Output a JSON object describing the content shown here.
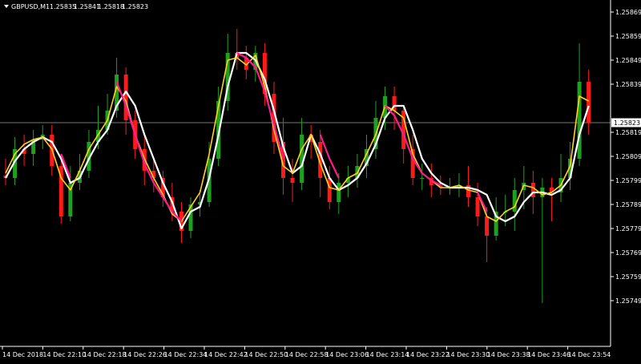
{
  "window": {
    "menu_icon": "triangle-down-icon",
    "symbol": "GBPUSD,M1",
    "ohlc": [
      "1.25835",
      "1.25841",
      "1.25818",
      "1.25823"
    ]
  },
  "colors": {
    "background": "#000000",
    "bull": "#1fa01f",
    "bear": "#ff1a1a",
    "ma_white": "#ffffff",
    "ma_yellow": "#ffd21e",
    "ma_magenta": "#ff1a8c",
    "bid_line": "#a0a0a0",
    "axis": "#ffffff"
  },
  "chart_data": {
    "type": "candlestick",
    "symbol": "GBPUSD",
    "timeframe": "M1",
    "ylim": [
      1.25744,
      1.25874
    ],
    "y_ticks": [
      "1.25869",
      "1.25859",
      "1.25849",
      "1.25839",
      "1.25819",
      "1.25809",
      "1.25799",
      "1.25789",
      "1.25779",
      "1.25769",
      "1.25759",
      "1.25749"
    ],
    "current_price": "1.25823",
    "x_ticks": [
      "14 Dec 2018",
      "14 Dec 22:10",
      "14 Dec 22:18",
      "14 Dec 22:26",
      "14 Dec 22:34",
      "14 Dec 22:42",
      "14 Dec 22:50",
      "14 Dec 22:58",
      "14 Dec 23:06",
      "14 Dec 23:14",
      "14 Dec 23:22",
      "14 Dec 23:30",
      "14 Dec 23:38",
      "14 Dec 23:46",
      "14 Dec 23:54"
    ],
    "series": [
      {
        "name": "",
        "color": "white",
        "values": [
          1.258,
          1.25807,
          1.25812,
          1.25815,
          1.25817,
          1.25815,
          1.25808,
          1.25798,
          1.258,
          1.25808,
          1.25815,
          1.2582,
          1.2583,
          1.25836,
          1.2583,
          1.25818,
          1.25808,
          1.25798,
          1.2579,
          1.25779,
          1.25786,
          1.25788,
          1.258,
          1.25818,
          1.25838,
          1.25852,
          1.25852,
          1.25849,
          1.25841,
          1.25828,
          1.25813,
          1.25802,
          1.25805,
          1.25818,
          1.2581,
          1.258,
          1.25795,
          1.25797,
          1.258,
          1.25806,
          1.25814,
          1.25825,
          1.2583,
          1.2583,
          1.2582,
          1.25808,
          1.25802,
          1.25798,
          1.25796,
          1.25796,
          1.25796,
          1.25795,
          1.25793,
          1.25784,
          1.25782,
          1.25784,
          1.2579,
          1.25794,
          1.25794,
          1.25793,
          1.25795,
          1.258,
          1.25818,
          1.2583
        ]
      },
      {
        "name": "",
        "color": "yellow",
        "values": [
          1.25802,
          1.2581,
          1.25814,
          1.25816,
          1.25817,
          1.25812,
          1.258,
          1.25795,
          1.25803,
          1.25812,
          1.25818,
          1.25824,
          1.25838,
          1.25832,
          1.25818,
          1.25808,
          1.258,
          1.25793,
          1.25785,
          1.25782,
          1.25788,
          1.25794,
          1.2581,
          1.2583,
          1.25849,
          1.2585,
          1.25847,
          1.25851,
          1.25838,
          1.2582,
          1.25805,
          1.25802,
          1.25812,
          1.25818,
          1.25806,
          1.25796,
          1.25795,
          1.258,
          1.25802,
          1.2581,
          1.25818,
          1.2583,
          1.25828,
          1.25825,
          1.2581,
          1.25802,
          1.25799,
          1.25796,
          1.25796,
          1.25797,
          1.25795,
          1.25794,
          1.25784,
          1.25782,
          1.25786,
          1.25788,
          1.25797,
          1.25796,
          1.25793,
          1.25794,
          1.25797,
          1.25805,
          1.25834,
          1.25832
        ]
      },
      {
        "name": "",
        "color": "magenta",
        "values": [
          null,
          null,
          null,
          null,
          null,
          null,
          1.2581,
          1.258,
          null,
          null,
          null,
          null,
          1.2584,
          1.2583,
          1.25818,
          1.25806,
          1.25798,
          1.25792,
          1.25786,
          1.25782,
          null,
          null,
          null,
          null,
          null,
          1.25852,
          1.2585,
          1.25846,
          1.25836,
          1.25822,
          1.25808,
          null,
          null,
          null,
          1.25818,
          1.25808,
          1.258,
          null,
          null,
          null,
          null,
          1.2583,
          1.25826,
          1.25818,
          1.25808,
          1.25802,
          1.25799,
          1.25797,
          null,
          null,
          null,
          1.25794,
          1.25786,
          null,
          null,
          null,
          null,
          null,
          null,
          null,
          null,
          null,
          null,
          null
        ]
      }
    ],
    "candles": [
      [
        1.25801,
        1.258,
        1.25808,
        1.25797
      ],
      [
        1.258,
        1.25812,
        1.25817,
        1.25797
      ],
      [
        1.25812,
        1.2581,
        1.25818,
        1.25805
      ],
      [
        1.2581,
        1.25816,
        1.2582,
        1.25805
      ],
      [
        1.25816,
        1.25818,
        1.25822,
        1.25812
      ],
      [
        1.25818,
        1.25805,
        1.25822,
        1.25801
      ],
      [
        1.25805,
        1.25784,
        1.2581,
        1.25781
      ],
      [
        1.25784,
        1.25798,
        1.25805,
        1.25782
      ],
      [
        1.25798,
        1.25803,
        1.2581,
        1.25795
      ],
      [
        1.25803,
        1.25815,
        1.2582,
        1.258
      ],
      [
        1.25815,
        1.2582,
        1.2583,
        1.25812
      ],
      [
        1.2582,
        1.25828,
        1.25835,
        1.25818
      ],
      [
        1.25828,
        1.25843,
        1.2585,
        1.25825
      ],
      [
        1.25843,
        1.25824,
        1.25846,
        1.25818
      ],
      [
        1.25824,
        1.25812,
        1.25828,
        1.25808
      ],
      [
        1.25812,
        1.25803,
        1.25818,
        1.25797
      ],
      [
        1.25803,
        1.258,
        1.25808,
        1.25794
      ],
      [
        1.258,
        1.25792,
        1.25803,
        1.25788
      ],
      [
        1.25792,
        1.25786,
        1.25798,
        1.25782
      ],
      [
        1.25786,
        1.25778,
        1.2579,
        1.25773
      ],
      [
        1.25778,
        1.25789,
        1.25792,
        1.25775
      ],
      [
        1.25789,
        1.2579,
        1.25795,
        1.25784
      ],
      [
        1.2579,
        1.25808,
        1.25815,
        1.25788
      ],
      [
        1.25808,
        1.25832,
        1.25838,
        1.25805
      ],
      [
        1.25832,
        1.25852,
        1.2586,
        1.25828
      ],
      [
        1.25852,
        1.2585,
        1.25862,
        1.25845
      ],
      [
        1.2585,
        1.25845,
        1.25855,
        1.25841
      ],
      [
        1.25845,
        1.25852,
        1.25855,
        1.2584
      ],
      [
        1.25852,
        1.25835,
        1.25856,
        1.2583
      ],
      [
        1.25835,
        1.25815,
        1.2584,
        1.2581
      ],
      [
        1.25815,
        1.258,
        1.25825,
        1.25793
      ],
      [
        1.258,
        1.25798,
        1.25808,
        1.2579
      ],
      [
        1.25798,
        1.25818,
        1.25825,
        1.25795
      ],
      [
        1.25818,
        1.25815,
        1.25822,
        1.25808
      ],
      [
        1.25815,
        1.258,
        1.2582,
        1.25792
      ],
      [
        1.258,
        1.2579,
        1.25805,
        1.25787
      ],
      [
        1.2579,
        1.25798,
        1.25802,
        1.25785
      ],
      [
        1.25798,
        1.258,
        1.25805,
        1.25792
      ],
      [
        1.258,
        1.25805,
        1.2581,
        1.25796
      ],
      [
        1.25805,
        1.25812,
        1.25818,
        1.258
      ],
      [
        1.25812,
        1.25825,
        1.25832,
        1.25808
      ],
      [
        1.25825,
        1.25834,
        1.25838,
        1.2582
      ],
      [
        1.25834,
        1.25828,
        1.25838,
        1.2582
      ],
      [
        1.25828,
        1.25812,
        1.2583,
        1.25806
      ],
      [
        1.25812,
        1.258,
        1.25818,
        1.25797
      ],
      [
        1.258,
        1.258,
        1.25806,
        1.25795
      ],
      [
        1.258,
        1.25797,
        1.25806,
        1.25792
      ],
      [
        1.25797,
        1.25796,
        1.25801,
        1.25793
      ],
      [
        1.25796,
        1.25796,
        1.258,
        1.25793
      ],
      [
        1.25796,
        1.25797,
        1.25802,
        1.25792
      ],
      [
        1.25797,
        1.25792,
        1.25805,
        1.25788
      ],
      [
        1.25792,
        1.25784,
        1.25798,
        1.2578
      ],
      [
        1.25784,
        1.25776,
        1.25788,
        1.25765
      ],
      [
        1.25776,
        1.25786,
        1.25792,
        1.25774
      ],
      [
        1.25786,
        1.25786,
        1.25793,
        1.2578
      ],
      [
        1.25786,
        1.25795,
        1.258,
        1.25778
      ],
      [
        1.25795,
        1.25798,
        1.25805,
        1.25787
      ],
      [
        1.25798,
        1.25792,
        1.25803,
        1.25785
      ],
      [
        1.25792,
        1.25796,
        1.258,
        1.25748
      ],
      [
        1.25796,
        1.25794,
        1.258,
        1.25782
      ],
      [
        1.25794,
        1.258,
        1.2581,
        1.2579
      ],
      [
        1.258,
        1.25808,
        1.25815,
        1.25795
      ],
      [
        1.25808,
        1.2584,
        1.25856,
        1.25805
      ],
      [
        1.2584,
        1.25823,
        1.25845,
        1.25818
      ]
    ]
  }
}
